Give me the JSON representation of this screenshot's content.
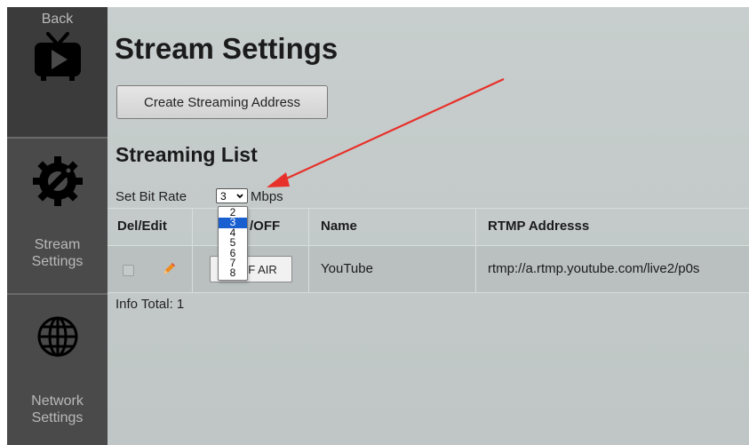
{
  "sidebar": {
    "items": [
      {
        "label": "Back",
        "icon": "tv-play-icon"
      },
      {
        "label_line1": "Stream",
        "label_line2": "Settings",
        "icon": "gear-wrench-icon"
      },
      {
        "label_line1": "Network",
        "label_line2": "Settings",
        "icon": "globe-icon"
      }
    ]
  },
  "main": {
    "title": "Stream Settings",
    "create_button": "Create Streaming Address",
    "list_title": "Streaming List",
    "bitrate": {
      "label": "Set Bit Rate",
      "selected": "3",
      "unit": "Mbps",
      "options": [
        "2",
        "3",
        "4",
        "5",
        "6",
        "7",
        "8"
      ]
    },
    "table": {
      "headers": [
        "Del/Edit",
        "ON/OFF",
        "Name",
        "RTMP Addresss"
      ],
      "header_visible_fragment": "/OFF",
      "rows": [
        {
          "onoff_fragment": "F AIR",
          "name": "YouTube",
          "rtmp": "rtmp://a.rtmp.youtube.com/live2/p0s"
        }
      ]
    },
    "info_total": "Info Total: 1"
  },
  "colors": {
    "sidebar_bg": "#4a4a4a",
    "main_bg": "#c3cac9",
    "selected_option": "#1a5fd0",
    "annotation_arrow": "#e8302a",
    "pencil": "#f08a1c"
  }
}
